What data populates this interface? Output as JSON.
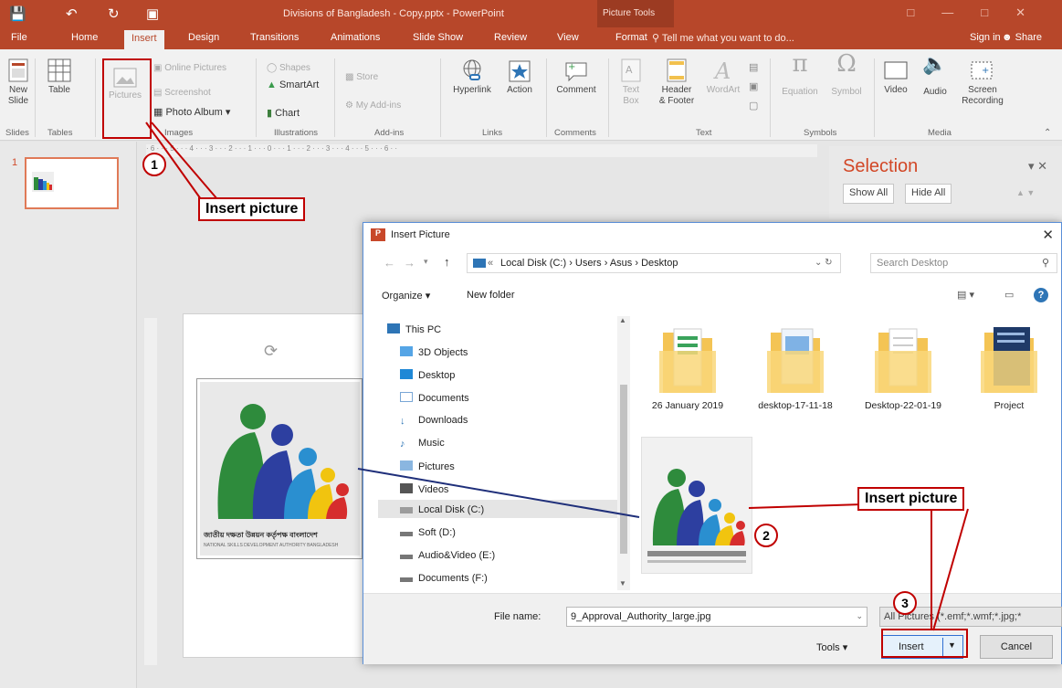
{
  "window": {
    "title": "Divisions of Bangladesh - Copy.pptx - PowerPoint",
    "context_tab": "Picture Tools"
  },
  "tabs": [
    "File",
    "Home",
    "Insert",
    "Design",
    "Transitions",
    "Animations",
    "Slide Show",
    "Review",
    "View",
    "Format"
  ],
  "tell_me": "Tell me what you want to do...",
  "signin": "Sign in",
  "share": "Share",
  "ribbon": {
    "slides": {
      "new_slide": "New\nSlide",
      "label": "Slides"
    },
    "tables": {
      "table": "Table",
      "label": "Tables"
    },
    "images": {
      "pictures": "Pictures",
      "online": "Online Pictures",
      "screenshot": "Screenshot",
      "album": "Photo Album",
      "label": "Images"
    },
    "illustrations": {
      "shapes": "Shapes",
      "smartart": "SmartArt",
      "chart": "Chart",
      "label": "Illustrations"
    },
    "addins": {
      "store": "Store",
      "myaddins": "My Add-ins",
      "label": "Add-ins"
    },
    "links": {
      "hyperlink": "Hyperlink",
      "action": "Action",
      "label": "Links"
    },
    "comments": {
      "comment": "Comment",
      "label": "Comments"
    },
    "text": {
      "textbox": "Text\nBox",
      "header": "Header\n& Footer",
      "wordart": "WordArt",
      "label": "Text"
    },
    "symbols": {
      "equation": "Equation",
      "symbol": "Symbol",
      "label": "Symbols"
    },
    "media": {
      "video": "Video",
      "audio": "Audio",
      "screen": "Screen\nRecording",
      "label": "Media"
    }
  },
  "slide_panel": {
    "number": "1"
  },
  "selection_pane": {
    "title": "Selection",
    "show_all": "Show All",
    "hide_all": "Hide All"
  },
  "dialog": {
    "title": "Insert Picture",
    "address": [
      "Local Disk (C:)",
      "Users",
      "Asus",
      "Desktop"
    ],
    "search_placeholder": "Search Desktop",
    "organize": "Organize",
    "new_folder": "New folder",
    "nav_items": [
      "This PC",
      "3D Objects",
      "Desktop",
      "Documents",
      "Downloads",
      "Music",
      "Pictures",
      "Videos",
      "Local Disk (C:)",
      "Soft (D:)",
      "Audio&Video (E:)",
      "Documents (F:)"
    ],
    "files": [
      "26 January 2019",
      "desktop-17-11-18",
      "Desktop-22-01-19",
      "Project"
    ],
    "file_name_label": "File name:",
    "file_name": "9_Approval_Authority_large.jpg",
    "file_type": "All Pictures (*.emf;*.wmf;*.jpg;*",
    "tools": "Tools",
    "insert": "Insert",
    "cancel": "Cancel"
  },
  "annotations": {
    "callout_1": "Insert picture",
    "callout_2": "Insert picture",
    "step1": "1",
    "step2": "2",
    "step3": "3"
  },
  "ruler_top": "· 6 · · · 5 · · · 4 · · · 3 · · · 2 · · · 1 · · · 0 · · · 1 · · · 2 · · · 3 · · · 4 · · · 5 · · · 6 · ·",
  "logo_text": "জাতীয় দক্ষতা উন্নয়ন কর্তৃপক্ষ বাংলাদেশ",
  "logo_subtext": "NATIONAL SKILLS DEVELOPMENT AUTHORITY BANGLADESH",
  "colors": {
    "accent": "#b7472a",
    "annotation": "#c00000",
    "dialog_border": "#5a8fd8"
  }
}
